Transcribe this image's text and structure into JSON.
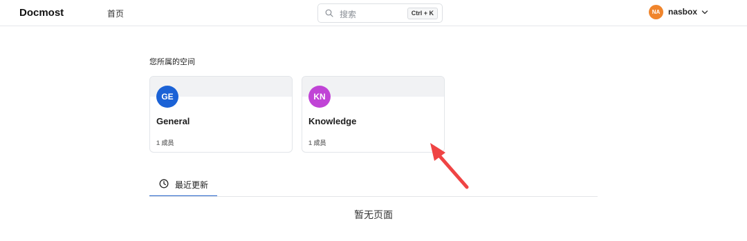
{
  "header": {
    "logo": "Docmost",
    "nav_home": "首页",
    "search": {
      "placeholder": "搜索",
      "shortcut": "Ctrl + K"
    },
    "user": {
      "initials": "NA",
      "name": "nasbox",
      "avatar_color": "#f0852c"
    }
  },
  "spaces": {
    "title": "您所属的空间",
    "items": [
      {
        "initials": "GE",
        "name": "General",
        "members": "1 成员",
        "color": "#1b62d6"
      },
      {
        "initials": "KN",
        "name": "Knowledge",
        "members": "1 成员",
        "color": "#c044d6"
      }
    ]
  },
  "recent": {
    "tab_label": "最近更新",
    "empty_text": "暂无页面",
    "accent": "#2563c9"
  },
  "annotation": {
    "arrow_color": "#ef4444"
  }
}
